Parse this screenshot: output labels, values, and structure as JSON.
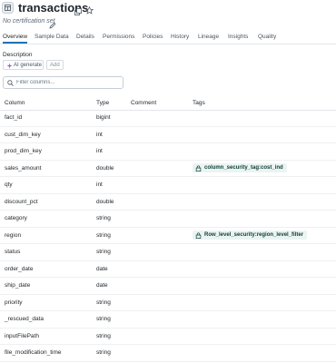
{
  "header": {
    "title": "transactions",
    "certification": "No certification set",
    "icons": [
      "table-icon",
      "copy-icon",
      "star-icon",
      "pencil-icon"
    ]
  },
  "tabs": [
    {
      "label": "Overview",
      "active": true
    },
    {
      "label": "Sample Data"
    },
    {
      "label": "Details"
    },
    {
      "label": "Permissions"
    },
    {
      "label": "Policies"
    },
    {
      "label": "History"
    },
    {
      "label": "Lineage"
    },
    {
      "label": "Insights"
    },
    {
      "label": "Quality"
    }
  ],
  "description": {
    "label": "Description",
    "ai_generate_label": "AI generate",
    "add_label": "Add"
  },
  "filter": {
    "placeholder": "Filter columns..."
  },
  "table": {
    "headers": {
      "column": "Column",
      "type": "Type",
      "comment": "Comment",
      "tags": "Tags"
    },
    "rows": [
      {
        "name": "fact_id",
        "type": "bigint"
      },
      {
        "name": "cust_dim_key",
        "type": "int"
      },
      {
        "name": "prod_dim_key",
        "type": "int"
      },
      {
        "name": "sales_amount",
        "type": "double",
        "tag_key": "column_security_tag",
        "tag_value": "cost_ind"
      },
      {
        "name": "qty",
        "type": "int"
      },
      {
        "name": "discount_pct",
        "type": "double"
      },
      {
        "name": "category",
        "type": "string"
      },
      {
        "name": "region",
        "type": "string",
        "tag_key": "Row_level_security",
        "tag_value": "region_level_filter"
      },
      {
        "name": "status",
        "type": "string"
      },
      {
        "name": "order_date",
        "type": "date"
      },
      {
        "name": "ship_date",
        "type": "date"
      },
      {
        "name": "priority",
        "type": "string"
      },
      {
        "name": "_rescued_data",
        "type": "string"
      },
      {
        "name": "inputFilePath",
        "type": "string"
      },
      {
        "name": "file_modification_time",
        "type": "string"
      }
    ]
  },
  "colors": {
    "accent": "#2272b4",
    "tag_bg": "#eaf4f1",
    "tag_text": "#12403a"
  }
}
